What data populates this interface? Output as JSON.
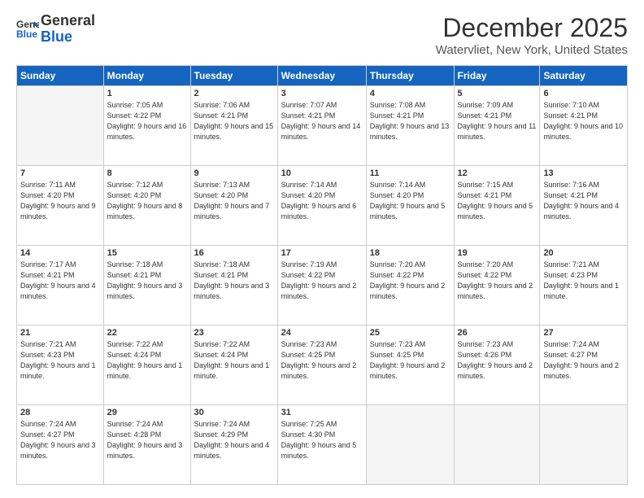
{
  "header": {
    "logo_line1": "General",
    "logo_line2": "Blue",
    "title": "December 2025",
    "subtitle": "Watervliet, New York, United States"
  },
  "calendar": {
    "days_of_week": [
      "Sunday",
      "Monday",
      "Tuesday",
      "Wednesday",
      "Thursday",
      "Friday",
      "Saturday"
    ],
    "weeks": [
      [
        {
          "day": "",
          "sunrise": "",
          "sunset": "",
          "daylight": "",
          "empty": true
        },
        {
          "day": "1",
          "sunrise": "Sunrise: 7:05 AM",
          "sunset": "Sunset: 4:22 PM",
          "daylight": "Daylight: 9 hours and 16 minutes."
        },
        {
          "day": "2",
          "sunrise": "Sunrise: 7:06 AM",
          "sunset": "Sunset: 4:21 PM",
          "daylight": "Daylight: 9 hours and 15 minutes."
        },
        {
          "day": "3",
          "sunrise": "Sunrise: 7:07 AM",
          "sunset": "Sunset: 4:21 PM",
          "daylight": "Daylight: 9 hours and 14 minutes."
        },
        {
          "day": "4",
          "sunrise": "Sunrise: 7:08 AM",
          "sunset": "Sunset: 4:21 PM",
          "daylight": "Daylight: 9 hours and 13 minutes."
        },
        {
          "day": "5",
          "sunrise": "Sunrise: 7:09 AM",
          "sunset": "Sunset: 4:21 PM",
          "daylight": "Daylight: 9 hours and 11 minutes."
        },
        {
          "day": "6",
          "sunrise": "Sunrise: 7:10 AM",
          "sunset": "Sunset: 4:21 PM",
          "daylight": "Daylight: 9 hours and 10 minutes."
        }
      ],
      [
        {
          "day": "7",
          "sunrise": "Sunrise: 7:11 AM",
          "sunset": "Sunset: 4:20 PM",
          "daylight": "Daylight: 9 hours and 9 minutes."
        },
        {
          "day": "8",
          "sunrise": "Sunrise: 7:12 AM",
          "sunset": "Sunset: 4:20 PM",
          "daylight": "Daylight: 9 hours and 8 minutes."
        },
        {
          "day": "9",
          "sunrise": "Sunrise: 7:13 AM",
          "sunset": "Sunset: 4:20 PM",
          "daylight": "Daylight: 9 hours and 7 minutes."
        },
        {
          "day": "10",
          "sunrise": "Sunrise: 7:14 AM",
          "sunset": "Sunset: 4:20 PM",
          "daylight": "Daylight: 9 hours and 6 minutes."
        },
        {
          "day": "11",
          "sunrise": "Sunrise: 7:14 AM",
          "sunset": "Sunset: 4:20 PM",
          "daylight": "Daylight: 9 hours and 5 minutes."
        },
        {
          "day": "12",
          "sunrise": "Sunrise: 7:15 AM",
          "sunset": "Sunset: 4:21 PM",
          "daylight": "Daylight: 9 hours and 5 minutes."
        },
        {
          "day": "13",
          "sunrise": "Sunrise: 7:16 AM",
          "sunset": "Sunset: 4:21 PM",
          "daylight": "Daylight: 9 hours and 4 minutes."
        }
      ],
      [
        {
          "day": "14",
          "sunrise": "Sunrise: 7:17 AM",
          "sunset": "Sunset: 4:21 PM",
          "daylight": "Daylight: 9 hours and 4 minutes."
        },
        {
          "day": "15",
          "sunrise": "Sunrise: 7:18 AM",
          "sunset": "Sunset: 4:21 PM",
          "daylight": "Daylight: 9 hours and 3 minutes."
        },
        {
          "day": "16",
          "sunrise": "Sunrise: 7:18 AM",
          "sunset": "Sunset: 4:21 PM",
          "daylight": "Daylight: 9 hours and 3 minutes."
        },
        {
          "day": "17",
          "sunrise": "Sunrise: 7:19 AM",
          "sunset": "Sunset: 4:22 PM",
          "daylight": "Daylight: 9 hours and 2 minutes."
        },
        {
          "day": "18",
          "sunrise": "Sunrise: 7:20 AM",
          "sunset": "Sunset: 4:22 PM",
          "daylight": "Daylight: 9 hours and 2 minutes."
        },
        {
          "day": "19",
          "sunrise": "Sunrise: 7:20 AM",
          "sunset": "Sunset: 4:22 PM",
          "daylight": "Daylight: 9 hours and 2 minutes."
        },
        {
          "day": "20",
          "sunrise": "Sunrise: 7:21 AM",
          "sunset": "Sunset: 4:23 PM",
          "daylight": "Daylight: 9 hours and 1 minute."
        }
      ],
      [
        {
          "day": "21",
          "sunrise": "Sunrise: 7:21 AM",
          "sunset": "Sunset: 4:23 PM",
          "daylight": "Daylight: 9 hours and 1 minute."
        },
        {
          "day": "22",
          "sunrise": "Sunrise: 7:22 AM",
          "sunset": "Sunset: 4:24 PM",
          "daylight": "Daylight: 9 hours and 1 minute."
        },
        {
          "day": "23",
          "sunrise": "Sunrise: 7:22 AM",
          "sunset": "Sunset: 4:24 PM",
          "daylight": "Daylight: 9 hours and 1 minute."
        },
        {
          "day": "24",
          "sunrise": "Sunrise: 7:23 AM",
          "sunset": "Sunset: 4:25 PM",
          "daylight": "Daylight: 9 hours and 2 minutes."
        },
        {
          "day": "25",
          "sunrise": "Sunrise: 7:23 AM",
          "sunset": "Sunset: 4:25 PM",
          "daylight": "Daylight: 9 hours and 2 minutes."
        },
        {
          "day": "26",
          "sunrise": "Sunrise: 7:23 AM",
          "sunset": "Sunset: 4:26 PM",
          "daylight": "Daylight: 9 hours and 2 minutes."
        },
        {
          "day": "27",
          "sunrise": "Sunrise: 7:24 AM",
          "sunset": "Sunset: 4:27 PM",
          "daylight": "Daylight: 9 hours and 2 minutes."
        }
      ],
      [
        {
          "day": "28",
          "sunrise": "Sunrise: 7:24 AM",
          "sunset": "Sunset: 4:27 PM",
          "daylight": "Daylight: 9 hours and 3 minutes."
        },
        {
          "day": "29",
          "sunrise": "Sunrise: 7:24 AM",
          "sunset": "Sunset: 4:28 PM",
          "daylight": "Daylight: 9 hours and 3 minutes."
        },
        {
          "day": "30",
          "sunrise": "Sunrise: 7:24 AM",
          "sunset": "Sunset: 4:29 PM",
          "daylight": "Daylight: 9 hours and 4 minutes."
        },
        {
          "day": "31",
          "sunrise": "Sunrise: 7:25 AM",
          "sunset": "Sunset: 4:30 PM",
          "daylight": "Daylight: 9 hours and 5 minutes."
        },
        {
          "day": "",
          "sunrise": "",
          "sunset": "",
          "daylight": "",
          "empty": true
        },
        {
          "day": "",
          "sunrise": "",
          "sunset": "",
          "daylight": "",
          "empty": true
        },
        {
          "day": "",
          "sunrise": "",
          "sunset": "",
          "daylight": "",
          "empty": true
        }
      ]
    ]
  }
}
